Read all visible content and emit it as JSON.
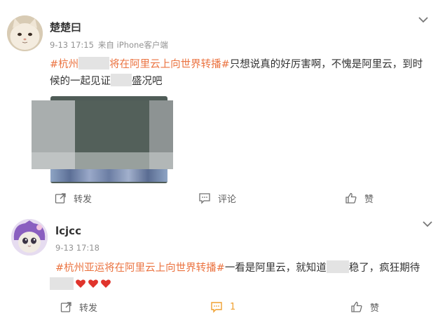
{
  "posts": [
    {
      "user": "楚楚曰",
      "time": "9-13 17:15",
      "source": "来自 iPhone客户端",
      "line1": {
        "topic_a": "#杭州",
        "topic_b": "将在阿里云上向世界转播#",
        "rest": "只想说真的好厉害啊，不愧是阿里云，到时"
      },
      "line2": {
        "a": "候的一起见证",
        "b": "盛况吧"
      },
      "actions": {
        "repost": "转发",
        "comment": "评论",
        "like": "赞"
      }
    },
    {
      "user": "lcjcc",
      "time": "9-13 17:18",
      "line1": {
        "topic": "#杭州亚运将在阿里云上向世界转播#",
        "a": "一看是阿里云，就知道",
        "b": "稳了，疯狂期待"
      },
      "actions": {
        "repost": "转发",
        "comment": "1",
        "like": "赞"
      }
    }
  ],
  "colors": {
    "topic": "#eb7340",
    "meta": "#939393",
    "heart": "#e0342c",
    "comment_active": "#f0a030"
  }
}
